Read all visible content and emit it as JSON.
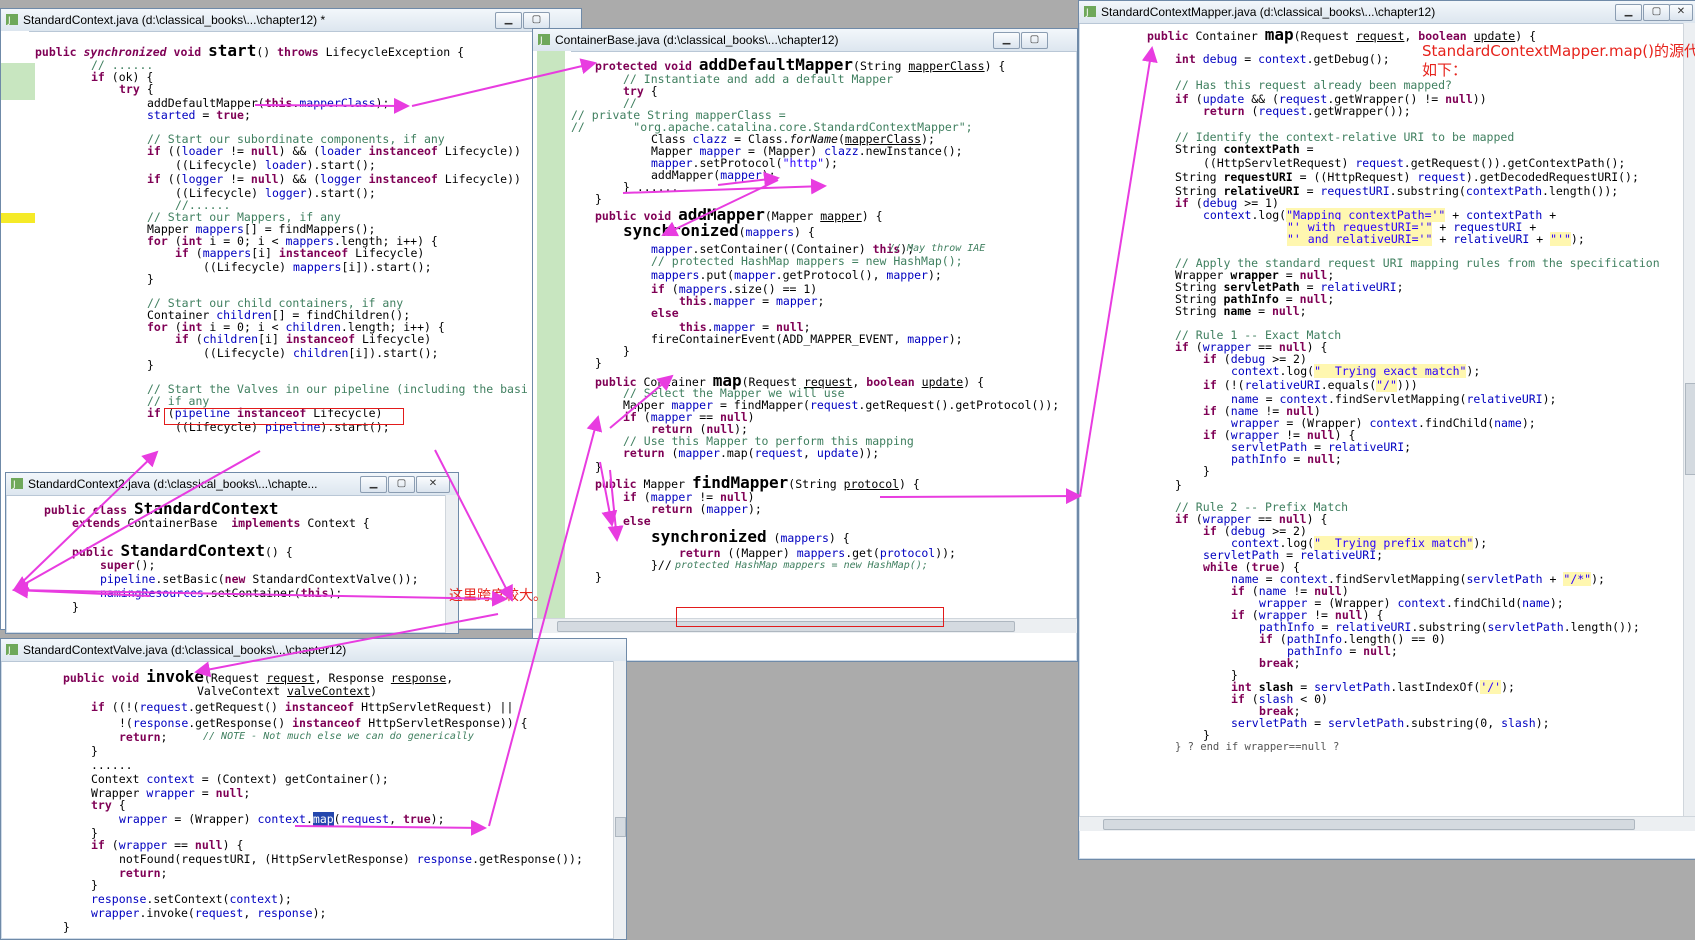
{
  "windows": {
    "standard_context": {
      "title": "StandardContext.java (d:\\classical_books\\...\\chapter12) *",
      "lines": [
        "public synchronized void start() throws LifecycleException {",
        "// ......",
        "if (ok) {",
        "try {",
        "addDefaultMapper(this.mapperClass);",
        "started = true;",
        "// Start our subordinate components, if any",
        "if ((loader != null) && (loader instanceof Lifecycle))",
        "((Lifecycle) loader).start();",
        "if ((logger != null) && (logger instanceof Lifecycle))",
        "((Lifecycle) logger).start();",
        "//......",
        "// Start our Mappers, if any",
        "Mapper mappers[] = findMappers();",
        "for (int i = 0; i < mappers.length; i++) {",
        "if (mappers[i] instanceof Lifecycle)",
        "((Lifecycle) mappers[i]).start();",
        "}",
        "// Start our child containers, if any",
        "Container children[] = findChildren();",
        "for (int i = 0; i < children.length; i++) {",
        "if (children[i] instanceof Lifecycle)",
        "((Lifecycle) children[i]).start();",
        "}",
        "// Start the Valves in our pipeline (including the basi",
        "// if any",
        "if (pipeline instanceof Lifecycle)",
        "((Lifecycle) pipeline).start();"
      ]
    },
    "standard_context2": {
      "title": "StandardContext2.java (d:\\classical_books\\...\\chapte...",
      "lines": [
        "public class StandardContext",
        "extends ContainerBase  implements Context {",
        "public StandardContext() {",
        "super();",
        "pipeline.setBasic(new StandardContextValve());",
        "namingResources.setContainer(this);",
        "}"
      ]
    },
    "container_base": {
      "title": "ContainerBase.java (d:\\classical_books\\...\\chapter12)",
      "lines": [
        "protected void addDefaultMapper(String mapperClass) {",
        "// Instantiate and add a default Mapper",
        "try {",
        "//",
        "// private String mapperClass =",
        "//       \"org.apache.catalina.core.StandardContextMapper\";",
        "Class clazz = Class.forName(mapperClass);",
        "Mapper mapper = (Mapper) clazz.newInstance();",
        "mapper.setProtocol(\"http\");",
        "addMapper(mapper);",
        "} ......",
        "}",
        "public void addMapper(Mapper mapper) {",
        "synchronized(mappers) {",
        "mapper.setContainer((Container) this);",
        "// May throw IAE",
        "// protected HashMap mappers = new HashMap();",
        "mappers.put(mapper.getProtocol(), mapper);",
        "if (mappers.size() == 1)",
        "this.mapper = mapper;",
        "else",
        "this.mapper = null;",
        "fireContainerEvent(ADD_MAPPER_EVENT, mapper);",
        "}",
        "}",
        "public Container map(Request request, boolean update) {",
        "// Select the Mapper we will use",
        "Mapper mapper = findMapper(request.getRequest().getProtocol());",
        "if (mapper == null)",
        "return (null);",
        "// Use this Mapper to perform this mapping",
        "return (mapper.map(request, update));",
        "}",
        "public Mapper findMapper(String protocol) {",
        "if (mapper != null)",
        "return (mapper);",
        "else",
        "synchronized (mappers) {",
        "return ((Mapper) mappers.get(protocol));",
        "}//",
        "protected HashMap mappers = new HashMap();",
        "}"
      ]
    },
    "standard_context_valve": {
      "title": "StandardContextValve.java (d:\\classical_books\\...\\chapter12)",
      "lines": [
        "public void invoke(Request request, Response response,",
        "ValveContext valveContext)",
        "if ((!(request.getRequest() instanceof HttpServletRequest) ||",
        "!(response.getResponse() instanceof HttpServletResponse)) {",
        "return;",
        "// NOTE - Not much else we can do generically",
        "}",
        "......",
        "Context context = (Context) getContainer();",
        "Wrapper wrapper = null;",
        "try {",
        "wrapper = (Wrapper) context.map(request, true);",
        "}",
        "if (wrapper == null) {",
        "notFound(requestURI, (HttpServletResponse) response.getResponse());",
        "return;",
        "}",
        "response.setContext(context);",
        "wrapper.invoke(request, response);",
        "}"
      ]
    },
    "standard_context_mapper": {
      "title": "StandardContextMapper.java (d:\\classical_books\\...\\chapter12)",
      "lines": [
        "public Container map(Request request, boolean update) {",
        "int debug = context.getDebug();",
        "// Has this request already been mapped?",
        "if (update && (request.getWrapper() != null))",
        "return (request.getWrapper());",
        "// Identify the context-relative URI to be mapped",
        "String contextPath =",
        "((HttpServletRequest) request.getRequest()).getContextPath();",
        "String requestURI = ((HttpRequest) request).getDecodedRequestURI();",
        "String relativeURI = requestURI.substring(contextPath.length());",
        "if (debug >= 1)",
        "context.log(\"Mapping contextPath='\" + contextPath +",
        "\"' with requestURI='\" + requestURI +",
        "\"' and relativeURI='\" + relativeURI + \"'\");",
        "// Apply the standard request URI mapping rules from the specification",
        "Wrapper wrapper = null;",
        "String servletPath = relativeURI;",
        "String pathInfo = null;",
        "String name = null;",
        "// Rule 1 -- Exact Match",
        "if (wrapper == null) {",
        "if (debug >= 2)",
        "context.log(\"  Trying exact match\");",
        "if (!(relativeURI.equals(\"/\")))",
        "name = context.findServletMapping(relativeURI);",
        "if (name != null)",
        "wrapper = (Wrapper) context.findChild(name);",
        "if (wrapper != null) {",
        "servletPath = relativeURI;",
        "pathInfo = null;",
        "}",
        "}",
        "// Rule 2 -- Prefix Match",
        "if (wrapper == null) {",
        "if (debug >= 2)",
        "context.log(\"  Trying prefix match\");",
        "servletPath = relativeURI;",
        "while (true) {",
        "name = context.findServletMapping(servletPath + \"/*\");",
        "if (name != null)",
        "wrapper = (Wrapper) context.findChild(name);",
        "if (wrapper != null) {",
        "pathInfo = relativeURI.substring(servletPath.length());",
        "if (pathInfo.length() == 0)",
        "pathInfo = null;",
        "break;",
        "}",
        "int slash = servletPath.lastIndexOf('/');",
        "if (slash < 0)",
        "break;",
        "servletPath = servletPath.substring(0, slash);",
        "}",
        "} ? end if wrapper==null ?"
      ]
    }
  },
  "annotations": {
    "mapper_note_line1": "StandardContextMapper.map()的源代码",
    "mapper_note_line2": "如下：",
    "span_note": "这里跨度较大。"
  },
  "colors": {
    "arrow": "#e83ce0",
    "annotation_text": "#e6231c",
    "keyword": "#7f0055",
    "comment": "#3f7f5f",
    "field": "#0000c0",
    "string": "#2a00ff"
  }
}
